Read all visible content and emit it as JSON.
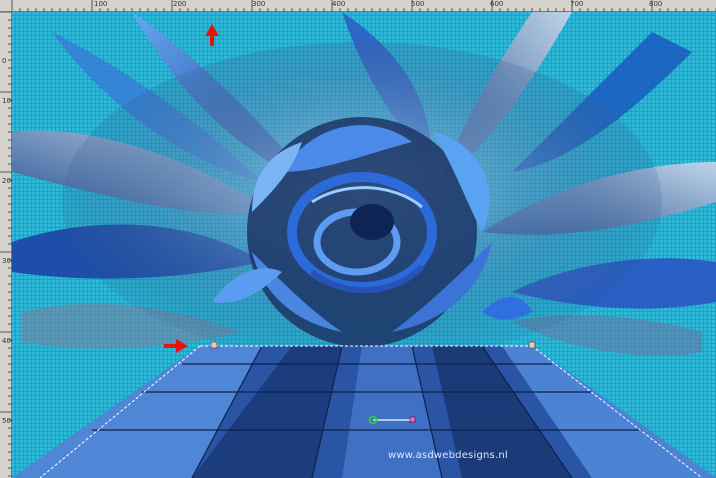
{
  "rulers": {
    "top_labels": [
      "100",
      "200",
      "300",
      "400",
      "500",
      "600",
      "700",
      "800"
    ],
    "left_labels": [
      "0",
      "100",
      "200",
      "300",
      "400",
      "500"
    ]
  },
  "watermark": "www.asdwebdesigns.nl",
  "colors": {
    "ruler_bg": "#d6d3cc",
    "sky_cyan": "#22a6c8",
    "deep_blue": "#0f2f6e",
    "bright_blue": "#3d7fe6",
    "floor_light": "#4f86d6",
    "floor_dark": "#1c3d7d",
    "arrow_red": "#e8140c",
    "selection_line": "#ffffff"
  },
  "icons": {
    "arrow_up": "red-up-arrow-icon",
    "arrow_right": "red-right-arrow-icon",
    "perspective_handle": "perspective-handle-icon"
  }
}
